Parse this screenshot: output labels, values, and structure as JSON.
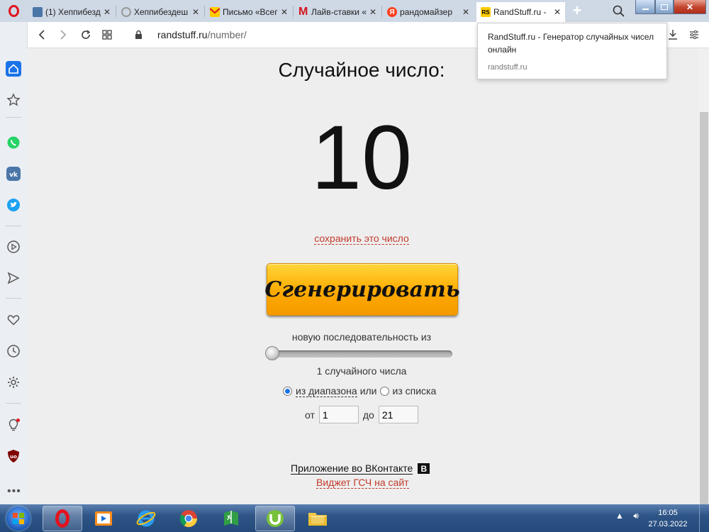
{
  "browser": {
    "tabs": [
      {
        "title": "(1) Хеппибезд",
        "icon": "vk-badge-icon",
        "active": false
      },
      {
        "title": "Хеппибездеш",
        "icon": "loading-ring-icon",
        "active": false
      },
      {
        "title": "Письмо «Всег",
        "icon": "mail-envelope-icon",
        "active": false
      },
      {
        "title": "Лайв-ставки «",
        "icon": "m-letter-icon",
        "active": false
      },
      {
        "title": "рандомайзер",
        "icon": "yandex-icon",
        "active": false
      },
      {
        "title": "RandStuff.ru -",
        "icon": "randstuff-icon",
        "active": true
      }
    ],
    "new_tab_label": "+",
    "address": {
      "domain": "randstuff.ru",
      "path": "/number/"
    },
    "tooltip": {
      "title": "RandStuff.ru - Генератор случайных чисел онлайн",
      "url": "randstuff.ru"
    }
  },
  "page": {
    "heading": "Случайное число:",
    "number": "10",
    "save_link": "сохранить это число",
    "generate_button": "Сгенерировать",
    "sequence_label": "новую последовательность из",
    "slider_value": 1,
    "count_label": "1 случайного числа",
    "mode": {
      "range_label": "из диапазона",
      "or": "или",
      "list_label": "из списка",
      "selected": "range"
    },
    "range": {
      "from_label": "от",
      "from_value": "1",
      "to_label": "до",
      "to_value": "21"
    },
    "vk_app_link": "Приложение во ВКонтакте",
    "vk_badge": "В",
    "widget_link": "Виджет ГСЧ на сайт"
  },
  "taskbar": {
    "time": "16:05",
    "date": "27.03.2022"
  },
  "colors": {
    "accent_red": "#c0392b",
    "button_orange": "#ffaa00",
    "opera_red": "#e2131e"
  }
}
